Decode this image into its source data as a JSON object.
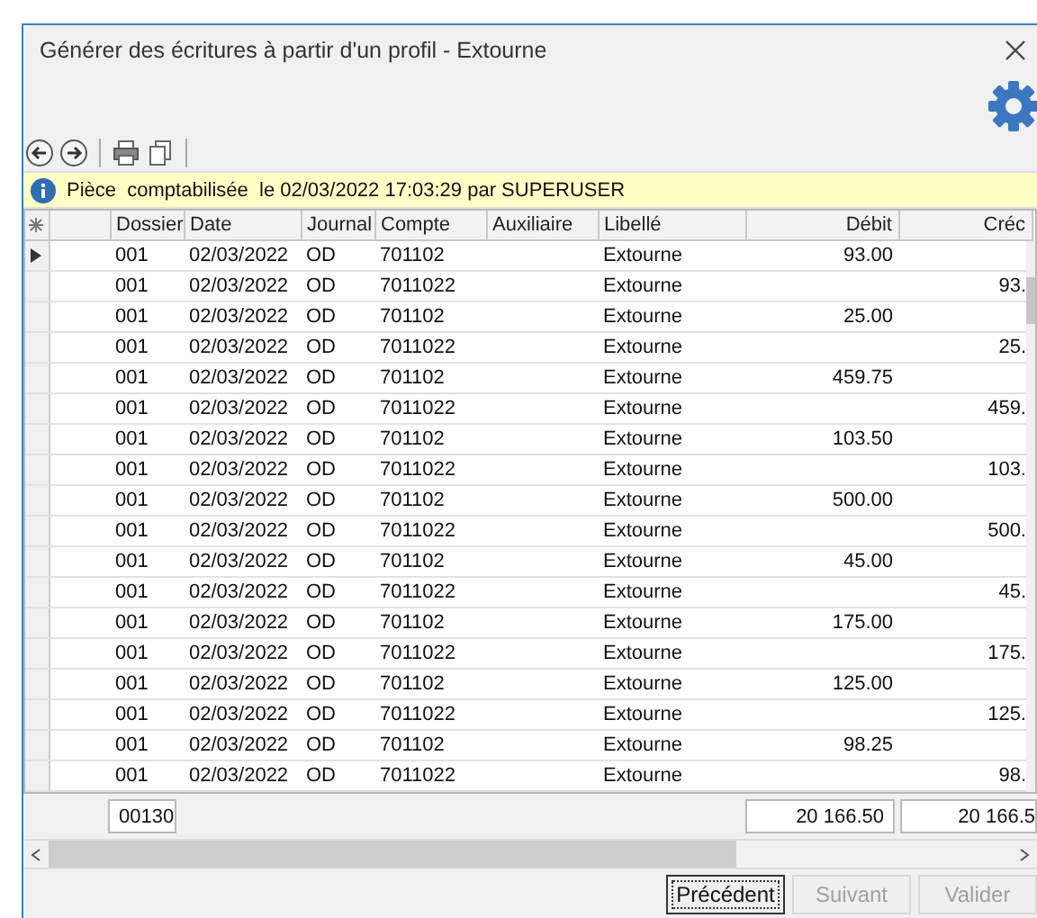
{
  "window": {
    "title": "Générer des écritures à partir d'un profil - Extourne"
  },
  "info_bar": {
    "text": "Pièce  comptabilisée  le 02/03/2022 17:03:29 par SUPERUSER"
  },
  "table": {
    "columns": [
      "Dossier",
      "Date",
      "Journal",
      "Compte",
      "Auxiliaire",
      "Libellé",
      "Débit",
      "Créc"
    ],
    "rows": [
      {
        "selected": true,
        "dossier": "001",
        "date": "02/03/2022",
        "journal": "OD",
        "compte": "701102",
        "libelle": "Extourne",
        "debit": "93.00",
        "credit": ""
      },
      {
        "selected": false,
        "dossier": "001",
        "date": "02/03/2022",
        "journal": "OD",
        "compte": "7011022",
        "libelle": "Extourne",
        "debit": "",
        "credit": "93."
      },
      {
        "selected": false,
        "dossier": "001",
        "date": "02/03/2022",
        "journal": "OD",
        "compte": "701102",
        "libelle": "Extourne",
        "debit": "25.00",
        "credit": ""
      },
      {
        "selected": false,
        "dossier": "001",
        "date": "02/03/2022",
        "journal": "OD",
        "compte": "7011022",
        "libelle": "Extourne",
        "debit": "",
        "credit": "25."
      },
      {
        "selected": false,
        "dossier": "001",
        "date": "02/03/2022",
        "journal": "OD",
        "compte": "701102",
        "libelle": "Extourne",
        "debit": "459.75",
        "credit": ""
      },
      {
        "selected": false,
        "dossier": "001",
        "date": "02/03/2022",
        "journal": "OD",
        "compte": "7011022",
        "libelle": "Extourne",
        "debit": "",
        "credit": "459."
      },
      {
        "selected": false,
        "dossier": "001",
        "date": "02/03/2022",
        "journal": "OD",
        "compte": "701102",
        "libelle": "Extourne",
        "debit": "103.50",
        "credit": ""
      },
      {
        "selected": false,
        "dossier": "001",
        "date": "02/03/2022",
        "journal": "OD",
        "compte": "7011022",
        "libelle": "Extourne",
        "debit": "",
        "credit": "103."
      },
      {
        "selected": false,
        "dossier": "001",
        "date": "02/03/2022",
        "journal": "OD",
        "compte": "701102",
        "libelle": "Extourne",
        "debit": "500.00",
        "credit": ""
      },
      {
        "selected": false,
        "dossier": "001",
        "date": "02/03/2022",
        "journal": "OD",
        "compte": "7011022",
        "libelle": "Extourne",
        "debit": "",
        "credit": "500."
      },
      {
        "selected": false,
        "dossier": "001",
        "date": "02/03/2022",
        "journal": "OD",
        "compte": "701102",
        "libelle": "Extourne",
        "debit": "45.00",
        "credit": ""
      },
      {
        "selected": false,
        "dossier": "001",
        "date": "02/03/2022",
        "journal": "OD",
        "compte": "7011022",
        "libelle": "Extourne",
        "debit": "",
        "credit": "45."
      },
      {
        "selected": false,
        "dossier": "001",
        "date": "02/03/2022",
        "journal": "OD",
        "compte": "701102",
        "libelle": "Extourne",
        "debit": "175.00",
        "credit": ""
      },
      {
        "selected": false,
        "dossier": "001",
        "date": "02/03/2022",
        "journal": "OD",
        "compte": "7011022",
        "libelle": "Extourne",
        "debit": "",
        "credit": "175."
      },
      {
        "selected": false,
        "dossier": "001",
        "date": "02/03/2022",
        "journal": "OD",
        "compte": "701102",
        "libelle": "Extourne",
        "debit": "125.00",
        "credit": ""
      },
      {
        "selected": false,
        "dossier": "001",
        "date": "02/03/2022",
        "journal": "OD",
        "compte": "7011022",
        "libelle": "Extourne",
        "debit": "",
        "credit": "125."
      },
      {
        "selected": false,
        "dossier": "001",
        "date": "02/03/2022",
        "journal": "OD",
        "compte": "701102",
        "libelle": "Extourne",
        "debit": "98.25",
        "credit": ""
      },
      {
        "selected": false,
        "dossier": "001",
        "date": "02/03/2022",
        "journal": "OD",
        "compte": "7011022",
        "libelle": "Extourne",
        "debit": "",
        "credit": "98."
      }
    ],
    "totals": {
      "count": "00130",
      "debit": "20 166.50",
      "credit": "20 166.5"
    }
  },
  "buttons": [
    {
      "label": "Précédent",
      "disabled": false,
      "focused": true
    },
    {
      "label": "Suivant",
      "disabled": true,
      "focused": false
    },
    {
      "label": "Valider",
      "disabled": true,
      "focused": false
    }
  ]
}
